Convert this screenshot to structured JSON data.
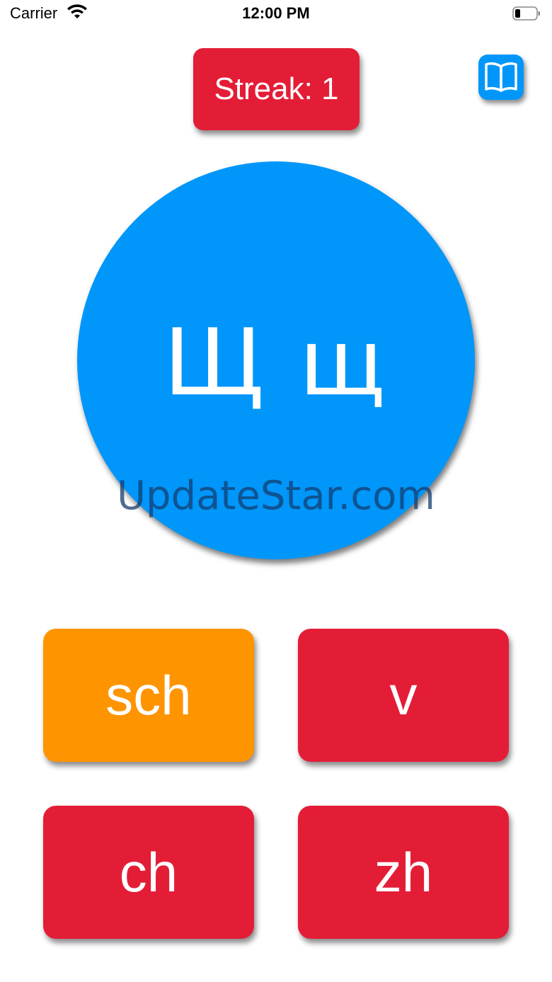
{
  "status_bar": {
    "carrier": "Carrier",
    "time": "12:00 PM",
    "wifi_icon": "wifi-icon",
    "battery_icon": "battery-icon"
  },
  "header": {
    "streak_label": "Streak: 1",
    "book_icon": "book-icon"
  },
  "card": {
    "letter": "Щ щ",
    "color": "#0096fa"
  },
  "watermark": "UpdateStar.com",
  "answers": [
    {
      "label": "sch",
      "state": "selected",
      "color": "#fe9400"
    },
    {
      "label": "v",
      "state": "default",
      "color": "#e41d37"
    },
    {
      "label": "ch",
      "state": "default",
      "color": "#e41d37"
    },
    {
      "label": "zh",
      "state": "default",
      "color": "#e41d37"
    }
  ],
  "colors": {
    "accent_red": "#e41d37",
    "accent_blue": "#0096fa",
    "accent_orange": "#fe9400"
  }
}
